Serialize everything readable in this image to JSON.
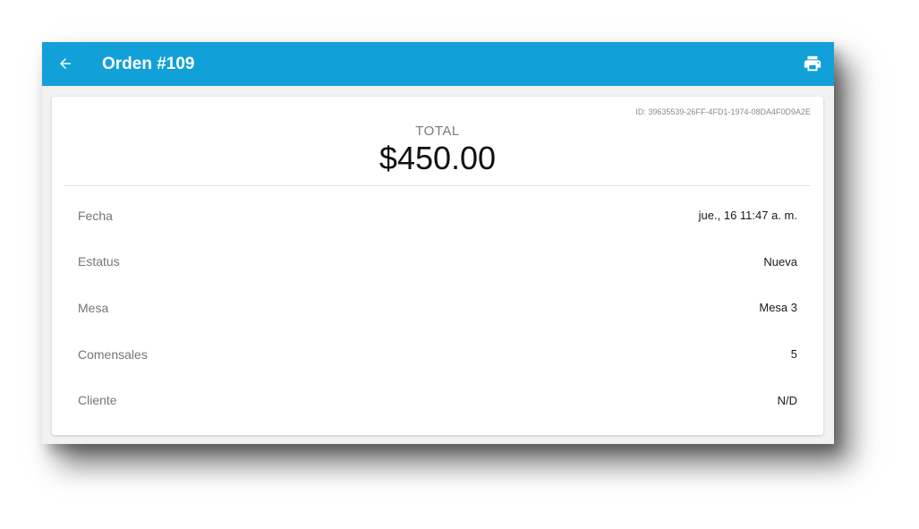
{
  "appbar": {
    "title": "Orden #109",
    "color": "#12a0d8",
    "back_icon": "arrow-back-icon",
    "print_icon": "printer-icon"
  },
  "order": {
    "id_text": "ID: 39635539-26FF-4FD1-1974-08DA4F0D9A2E",
    "total_label": "TOTAL",
    "total_value": "$450.00"
  },
  "details": [
    {
      "label": "Fecha",
      "value": "jue., 16 11:47 a. m."
    },
    {
      "label": "Estatus",
      "value": "Nueva"
    },
    {
      "label": "Mesa",
      "value": "Mesa 3"
    },
    {
      "label": "Comensales",
      "value": "5"
    },
    {
      "label": "Cliente",
      "value": "N/D"
    }
  ]
}
